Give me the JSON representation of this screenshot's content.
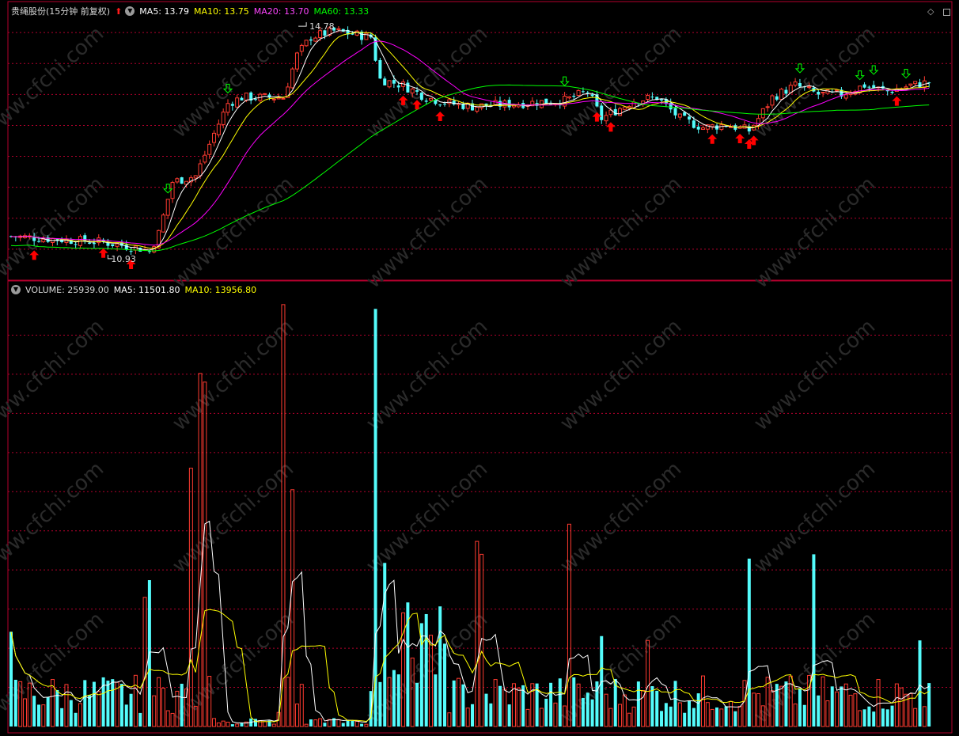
{
  "price_header": {
    "stock_name": "贵绳股份(15分钟 前复权)",
    "ma5": "MA5: 13.79",
    "ma10": "MA10: 13.75",
    "ma20": "MA20: 13.70",
    "ma60": "MA60: 13.33"
  },
  "volume_header": {
    "volume": "VOLUME: 25939.00",
    "ma5": "MA5: 11501.80",
    "ma10": "MA10: 13956.80"
  },
  "annotations": {
    "high_label": "14.78",
    "low_label": "10.93"
  },
  "watermark": "www.cfchi.com",
  "colors": {
    "background": "#000000",
    "grid_border": "#b3002d",
    "up_candle": "#ff3b30",
    "down_candle": "#54fcfc",
    "ma5": "#ffffff",
    "ma10": "#ffff00",
    "ma20": "#ff00ff",
    "ma60": "#00ff00",
    "buy_arrow": "#ff0000",
    "sell_arrow": "#00ff00"
  },
  "chart_data": [
    {
      "type": "candlestick",
      "price_range": [
        10.6,
        14.9
      ],
      "series": [
        {
          "name": "MA5",
          "color": "#ffffff"
        },
        {
          "name": "MA10",
          "color": "#ffff00"
        },
        {
          "name": "MA20",
          "color": "#ff00ff"
        },
        {
          "name": "MA60",
          "color": "#00ff00"
        }
      ],
      "high": 14.78,
      "low": 10.93,
      "buy_signals_count": 13,
      "sell_signals_count": 7
    },
    {
      "type": "bar",
      "series": [
        {
          "name": "VOLUME"
        },
        {
          "name": "MA5",
          "color": "#ffffff"
        },
        {
          "name": "MA10",
          "color": "#ffff00"
        }
      ]
    }
  ]
}
